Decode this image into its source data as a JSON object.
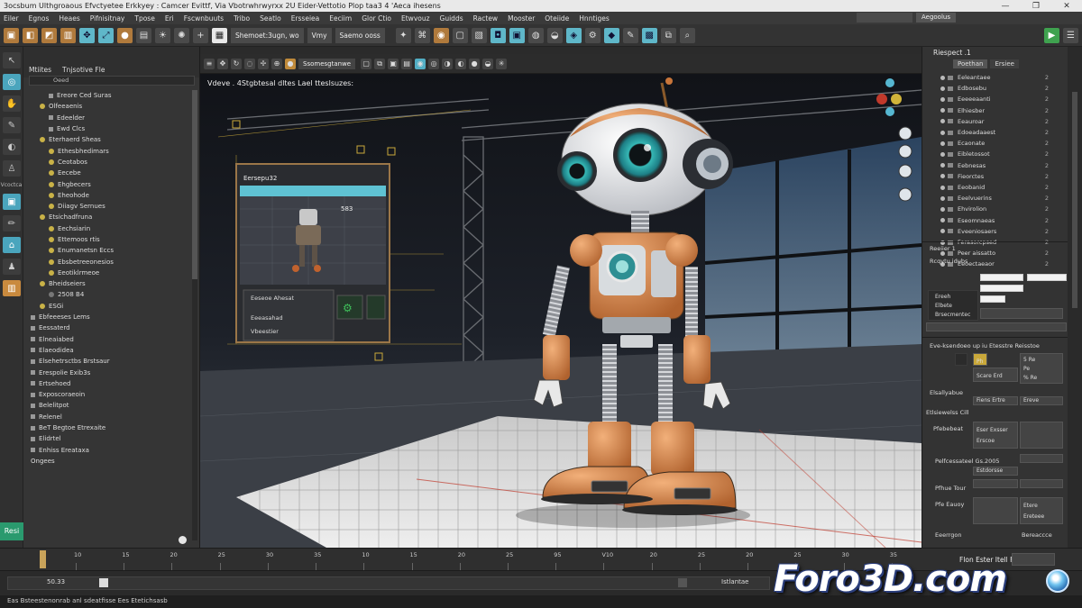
{
  "window": {
    "title": "3ocsbum Ulthgroaous Efvctyetee Erkkyey : Camcer Evittf, Via Vbotrwhrwyrxx 2U Eider-Vettotio Plop taa3 4 'Aeca ihesens",
    "controls": [
      "—",
      "❐",
      "✕"
    ]
  },
  "menu": {
    "items": [
      "Eiler",
      "Egnos",
      "Heaes",
      "Pifnisitnay",
      "Tpose",
      "Eri",
      "Fscwnbuuts",
      "Tribo",
      "Seatlo",
      "Ersseiea",
      "Eeciim",
      "Glor Ctio",
      "Etwvouz",
      "Guidds",
      "Ractew",
      "Mooster",
      "Oteiide",
      "Hnntiges"
    ],
    "right_boxes": [
      "",
      "Aegoolus"
    ]
  },
  "toolbar": {
    "text_buttons": [
      "Shemoet:3ugn, wo",
      "Vmy",
      "Saemo ooss"
    ]
  },
  "toolstrip": {
    "labels": [
      "Vcoctca"
    ],
    "bottom_button": "Resi"
  },
  "outliner": {
    "tabs": [
      "Mtiites",
      "Tnjsotive Fle"
    ],
    "filter_text": "Oeed",
    "rows": [
      {
        "indent": 2,
        "icon": "sq",
        "label": "Ereore Ced Suras"
      },
      {
        "indent": 1,
        "icon": "dot",
        "label": "Olfeeaenis"
      },
      {
        "indent": 2,
        "icon": "sq",
        "label": "Edeelder"
      },
      {
        "indent": 2,
        "icon": "sq",
        "label": "Ewd Clcs"
      },
      {
        "indent": 1,
        "icon": "dot",
        "label": "Eterhaerd Sheas"
      },
      {
        "indent": 2,
        "icon": "dot",
        "label": "Ethesbhedimars"
      },
      {
        "indent": 2,
        "icon": "dot",
        "label": "Ceotabos"
      },
      {
        "indent": 2,
        "icon": "dot",
        "label": "Eecebe"
      },
      {
        "indent": 2,
        "icon": "dot",
        "label": "Ehgbecers"
      },
      {
        "indent": 2,
        "icon": "dot",
        "label": "Eheohode"
      },
      {
        "indent": 2,
        "icon": "dot",
        "label": "Diiagv Sernues"
      },
      {
        "indent": 1,
        "icon": "dot",
        "label": "Etsichadfruna"
      },
      {
        "indent": 2,
        "icon": "dot",
        "label": "Eechsiarin"
      },
      {
        "indent": 2,
        "icon": "dot",
        "label": "Ettemoos rtis"
      },
      {
        "indent": 2,
        "icon": "dot",
        "label": "Enumanetsn Eccs"
      },
      {
        "indent": 2,
        "icon": "dot",
        "label": "Ebsbetreeonesios"
      },
      {
        "indent": 2,
        "icon": "dot",
        "label": "Eeotiklrmeoe"
      },
      {
        "indent": 1,
        "icon": "dot",
        "label": "Bheidseiers"
      },
      {
        "indent": 2,
        "icon": "grey",
        "label": "2508 B4"
      },
      {
        "indent": 1,
        "icon": "dot",
        "label": "ESGi"
      },
      {
        "indent": 0,
        "icon": "sq",
        "label": "Ebfeeeses Lems"
      },
      {
        "indent": 0,
        "icon": "sq",
        "label": "Eessaterd"
      },
      {
        "indent": 0,
        "icon": "sq",
        "label": "Elneaiabed"
      },
      {
        "indent": 0,
        "icon": "sq",
        "label": "Elaeodidea"
      },
      {
        "indent": 0,
        "icon": "sq",
        "label": "Elsehetrsctbs Brstsaur"
      },
      {
        "indent": 0,
        "icon": "sq",
        "label": "Erespolie Exib3s"
      },
      {
        "indent": 0,
        "icon": "sq",
        "label": "Ertsehoed"
      },
      {
        "indent": 0,
        "icon": "sq",
        "label": "Exposcoraeoin"
      },
      {
        "indent": 0,
        "icon": "sq",
        "label": "Belelitpot"
      },
      {
        "indent": 0,
        "icon": "sq",
        "label": "Relenel"
      },
      {
        "indent": 0,
        "icon": "sq",
        "label": "BeT Begtoe Etrexaite"
      },
      {
        "indent": 0,
        "icon": "sq",
        "label": "Elidrtel"
      },
      {
        "indent": 0,
        "icon": "sq",
        "label": "Enhiss Ereataxa"
      },
      {
        "indent": 0,
        "icon": "none",
        "label": "Ongees"
      }
    ]
  },
  "viewport": {
    "header_text": "Ssomesgtanwe",
    "label": "Vdeve . 4Stgbtesal dltes Lael tteslsuzes:",
    "panel_title": "Eersepu32",
    "panel_value": "583",
    "panel_rows": [
      "Eeseoe Ahesat",
      "Eeeasahad",
      "Vbeestier"
    ]
  },
  "right_panel": {
    "header": "Riespect .1",
    "tabs": [
      "Poethan",
      "Ersiee"
    ],
    "rows": [
      {
        "label": "Eeleantaee",
        "num": "2"
      },
      {
        "label": "Edbosebu",
        "num": "2"
      },
      {
        "label": "Eeeeeaanti",
        "num": "2"
      },
      {
        "label": "Elhiesber",
        "num": "2"
      },
      {
        "label": "Eeauroar",
        "num": "2"
      },
      {
        "label": "Edoeadaaest",
        "num": "2"
      },
      {
        "label": "Ecaonate",
        "num": "2"
      },
      {
        "label": "Eibletossot",
        "num": "2"
      },
      {
        "label": "Eebnesas",
        "num": "2"
      },
      {
        "label": "Fieorctes",
        "num": "2"
      },
      {
        "label": "Eeobanid",
        "num": "2"
      },
      {
        "label": "Eeelvuerins",
        "num": "2"
      },
      {
        "label": "Ehvirolion",
        "num": "2"
      },
      {
        "label": "Eseomnaeas",
        "num": "2"
      },
      {
        "label": "Eveeniosaers",
        "num": "2"
      },
      {
        "label": "Ferasorcpsed",
        "num": "2"
      },
      {
        "label": "Peer aissatto",
        "num": "2"
      },
      {
        "label": "Eeoectaeaor",
        "num": "2"
      }
    ],
    "section1_title": "Reeiier 1",
    "section1_sub": "Rcqytu idubs",
    "section1_fields": [
      "Ereeh",
      "Elbete",
      "Brsecmentec"
    ],
    "section2_title": "Eve-ksendoeo up iu Etesstre Reisstoe",
    "section2_values": [
      "5 Re",
      "Scare Erd",
      "Pe",
      "% Re",
      "Ph"
    ],
    "section2_label": "Elsallyabue",
    "section2_buttons": [
      "Fiens Ertre",
      "Ereve"
    ],
    "section3_title": "Etlsiewelss Cill",
    "section3_label": "Pfebebeat",
    "section3_values": [
      "Eser Exsser",
      "Erscoe"
    ],
    "section4_label": "Pelfcessateel Gs.2005",
    "section4_value": "Estdorsse",
    "section5_label": "Pfhue Tour",
    "section6_label": "Pfe Eauoy",
    "section6_values": [
      "Etere",
      "Ereteee"
    ],
    "bottom_label": "Eeerrgon",
    "bottom_value": "Bereaccce"
  },
  "timeline": {
    "ticks": [
      "10",
      "15",
      "20",
      "25",
      "30",
      "35",
      "10",
      "15",
      "20",
      "25",
      "95",
      "V10",
      "20",
      "25",
      "20",
      "25",
      "30",
      "35"
    ],
    "right_label": "Flon Ester Itell Fieo"
  },
  "status": {
    "left": "50.33",
    "mid": "Istlantae",
    "bottom": "Eas Bsteestenonrab anl sdeatfisse Ees Etetichsasb"
  },
  "watermark": {
    "text": "Foro3D.com"
  }
}
